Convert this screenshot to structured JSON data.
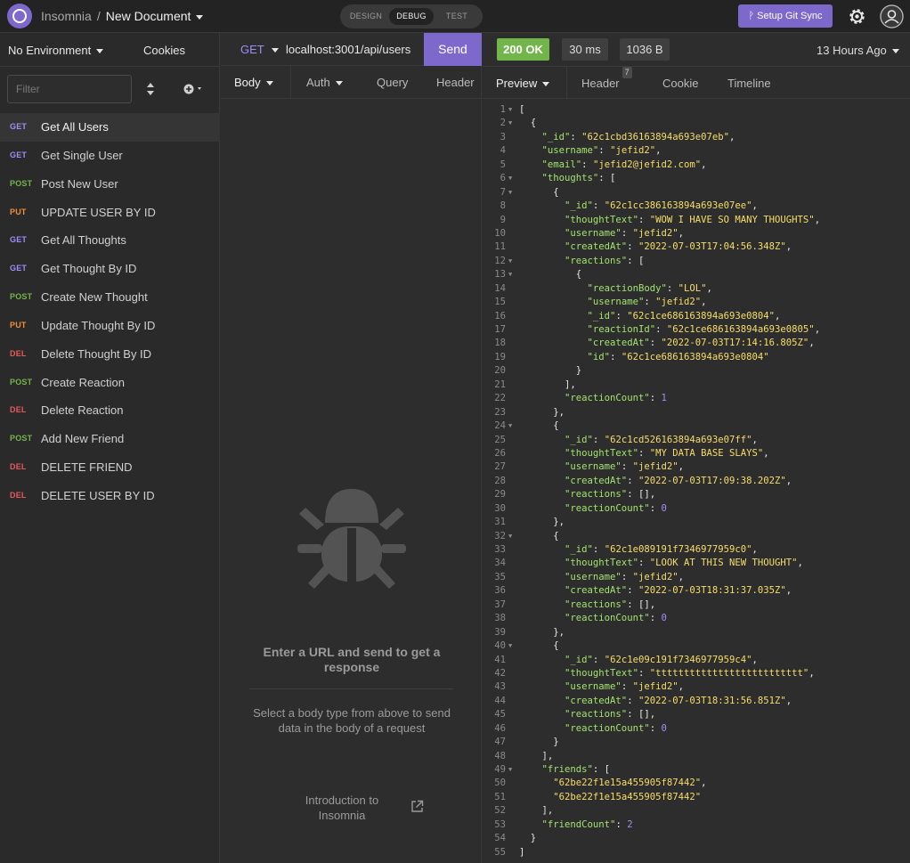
{
  "app": {
    "name": "Insomnia",
    "separator": "/",
    "document": "New Document"
  },
  "modes": {
    "design": "DESIGN",
    "debug": "DEBUG",
    "test": "TEST",
    "active": "debug"
  },
  "topbar": {
    "sync_label": "Setup Git Sync"
  },
  "sidebar": {
    "environment": "No Environment",
    "cookies": "Cookies",
    "filter_placeholder": "Filter",
    "requests": [
      {
        "method": "GET",
        "name": "Get All Users",
        "active": true
      },
      {
        "method": "GET",
        "name": "Get Single User"
      },
      {
        "method": "POST",
        "name": "Post New User"
      },
      {
        "method": "PUT",
        "name": "UPDATE USER BY ID"
      },
      {
        "method": "GET",
        "name": "Get All Thoughts"
      },
      {
        "method": "GET",
        "name": "Get Thought By ID"
      },
      {
        "method": "POST",
        "name": "Create New Thought"
      },
      {
        "method": "PUT",
        "name": "Update Thought By ID"
      },
      {
        "method": "DEL",
        "name": "Delete Thought By ID"
      },
      {
        "method": "POST",
        "name": "Create Reaction"
      },
      {
        "method": "DEL",
        "name": "Delete Reaction"
      },
      {
        "method": "POST",
        "name": "Add New Friend"
      },
      {
        "method": "DEL",
        "name": "DELETE FRIEND"
      },
      {
        "method": "DEL",
        "name": "DELETE USER BY ID"
      }
    ]
  },
  "method_colors": {
    "GET": "#9f8ef5",
    "POST": "#72b54a",
    "PUT": "#f08e3a",
    "DEL": "#e65a5a"
  },
  "request": {
    "method": "GET",
    "url": "localhost:3001/api/users",
    "send_label": "Send",
    "tabs": {
      "body": "Body",
      "auth": "Auth",
      "query": "Query",
      "header": "Header"
    },
    "empty_title": "Enter a URL and send to get a response",
    "body_hint": "Select a body type from above to send data in the body of a request",
    "intro_link": "Introduction to Insomnia"
  },
  "response": {
    "status": "200 OK",
    "time": "30 ms",
    "size": "1036 B",
    "age": "13 Hours Ago",
    "tabs": {
      "preview": "Preview",
      "header": "Header",
      "header_count": "7",
      "cookie": "Cookie",
      "timeline": "Timeline"
    },
    "lines": [
      {
        "t": "[",
        "f": true
      },
      {
        "t": "  {",
        "f": true
      },
      {
        "t": "    \"_id\": \"62c1cbd36163894a693e07eb\","
      },
      {
        "t": "    \"username\": \"jefid2\","
      },
      {
        "t": "    \"email\": \"jefid2@jefid2.com\","
      },
      {
        "t": "    \"thoughts\": [",
        "f": true
      },
      {
        "t": "      {",
        "f": true
      },
      {
        "t": "        \"_id\": \"62c1cc386163894a693e07ee\","
      },
      {
        "t": "        \"thoughtText\": \"WOW I HAVE SO MANY THOUGHTS\","
      },
      {
        "t": "        \"username\": \"jefid2\","
      },
      {
        "t": "        \"createdAt\": \"2022-07-03T17:04:56.348Z\","
      },
      {
        "t": "        \"reactions\": [",
        "f": true
      },
      {
        "t": "          {",
        "f": true
      },
      {
        "t": "            \"reactionBody\": \"LOL\","
      },
      {
        "t": "            \"username\": \"jefid2\","
      },
      {
        "t": "            \"_id\": \"62c1ce686163894a693e0804\","
      },
      {
        "t": "            \"reactionId\": \"62c1ce686163894a693e0805\","
      },
      {
        "t": "            \"createdAt\": \"2022-07-03T17:14:16.805Z\","
      },
      {
        "t": "            \"id\": \"62c1ce686163894a693e0804\""
      },
      {
        "t": "          }"
      },
      {
        "t": "        ],"
      },
      {
        "t": "        \"reactionCount\": 1"
      },
      {
        "t": "      },"
      },
      {
        "t": "      {",
        "f": true
      },
      {
        "t": "        \"_id\": \"62c1cd526163894a693e07ff\","
      },
      {
        "t": "        \"thoughtText\": \"MY DATA BASE SLAYS\","
      },
      {
        "t": "        \"username\": \"jefid2\","
      },
      {
        "t": "        \"createdAt\": \"2022-07-03T17:09:38.202Z\","
      },
      {
        "t": "        \"reactions\": [],"
      },
      {
        "t": "        \"reactionCount\": 0"
      },
      {
        "t": "      },"
      },
      {
        "t": "      {",
        "f": true
      },
      {
        "t": "        \"_id\": \"62c1e089191f7346977959c0\","
      },
      {
        "t": "        \"thoughtText\": \"LOOK AT THIS NEW THOUGHT\","
      },
      {
        "t": "        \"username\": \"jefid2\","
      },
      {
        "t": "        \"createdAt\": \"2022-07-03T18:31:37.035Z\","
      },
      {
        "t": "        \"reactions\": [],"
      },
      {
        "t": "        \"reactionCount\": 0"
      },
      {
        "t": "      },"
      },
      {
        "t": "      {",
        "f": true
      },
      {
        "t": "        \"_id\": \"62c1e09c191f7346977959c4\","
      },
      {
        "t": "        \"thoughtText\": \"tttttttttttttttttttttttttt\","
      },
      {
        "t": "        \"username\": \"jefid2\","
      },
      {
        "t": "        \"createdAt\": \"2022-07-03T18:31:56.851Z\","
      },
      {
        "t": "        \"reactions\": [],"
      },
      {
        "t": "        \"reactionCount\": 0"
      },
      {
        "t": "      }"
      },
      {
        "t": "    ],"
      },
      {
        "t": "    \"friends\": [",
        "f": true
      },
      {
        "t": "      \"62be22f1e15a455905f87442\","
      },
      {
        "t": "      \"62be22f1e15a455905f87442\""
      },
      {
        "t": "    ],"
      },
      {
        "t": "    \"friendCount\": 2"
      },
      {
        "t": "  }"
      },
      {
        "t": "]"
      }
    ]
  }
}
